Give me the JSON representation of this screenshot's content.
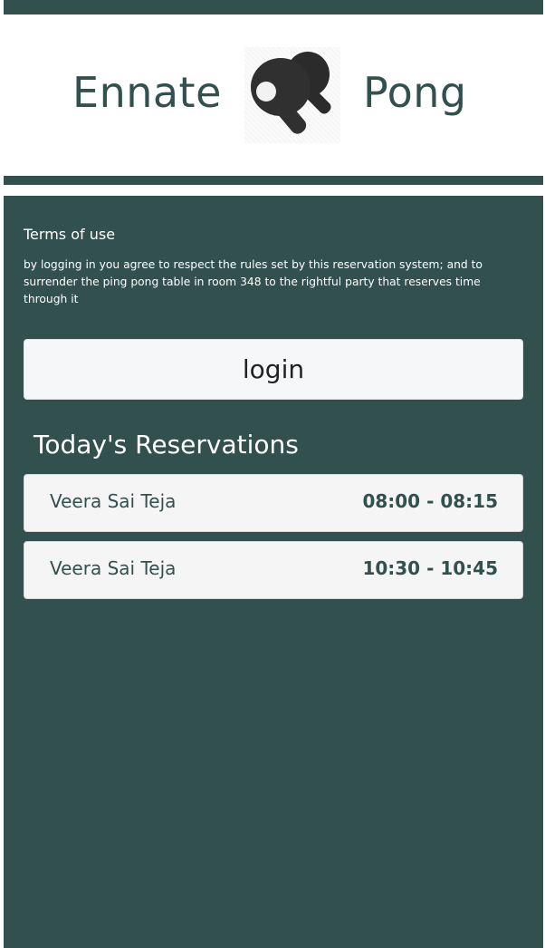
{
  "header": {
    "title_left": "Ennate",
    "title_right": "Pong"
  },
  "icons": {
    "logo": "ping-pong-paddles-icon"
  },
  "colors": {
    "brand": "#31504e",
    "card": "#f5f5f5",
    "button": "#f6f7f9"
  },
  "terms": {
    "title": "Terms of use",
    "text": "by logging in you agree to respect the rules set by this reservation system; and to surrender the ping pong table in room 348 to the rightful party that reserves time through it"
  },
  "login": {
    "label": "login"
  },
  "reservations": {
    "title": "Today's Reservations",
    "items": [
      {
        "name": "Veera Sai Teja",
        "time": "08:00 - 08:15"
      },
      {
        "name": "Veera Sai Teja",
        "time": "10:30 - 10:45"
      }
    ]
  }
}
